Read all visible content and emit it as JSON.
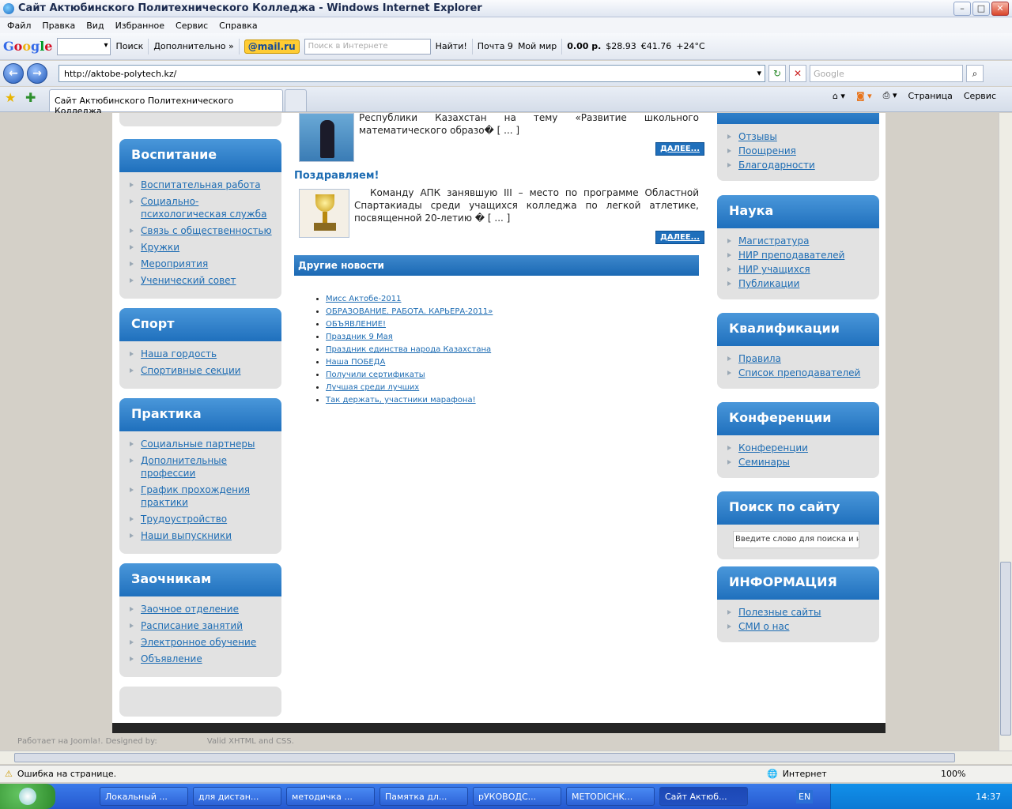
{
  "window": {
    "title": "Сайт Актюбинского Политехнического Колледжа - Windows Internet Explorer",
    "controls": {
      "min": "–",
      "max": "□",
      "close": "✕"
    }
  },
  "menu": [
    "Файл",
    "Правка",
    "Вид",
    "Избранное",
    "Сервис",
    "Справка"
  ],
  "toolbar": {
    "google_logo": [
      "G",
      "o",
      "o",
      "g",
      "l",
      "e"
    ],
    "search_label": "Поиск",
    "more_label": "Дополнительно »",
    "mailru": "@mail.ru",
    "internet_search_placeholder": "Поиск в Интернете",
    "find_label": "Найти!",
    "mail_label": "Почта 9",
    "myworld_label": "Мой мир",
    "balance": "0.00 р.",
    "usd": "$28.93",
    "eur": "€41.76",
    "weather": "+24°C"
  },
  "address": {
    "url": "http://aktobe-polytech.kz/",
    "back_icon": "←",
    "forward_icon": "→",
    "refresh_icon": "↻",
    "stop_icon": "✕",
    "search_placeholder": "Google",
    "search_icon": "⌕"
  },
  "tabs": {
    "active": "Сайт Актюбинского Политехнического Колледжа",
    "page_label": "Страница",
    "service_label": "Сервис"
  },
  "left_sidebar": [
    {
      "title": "Воспитание",
      "items": [
        "Воспитательная работа",
        "Социально-психологическая служба",
        "Связь с общественностью",
        "Кружки",
        "Мероприятия",
        "Ученический совет"
      ]
    },
    {
      "title": "Спорт",
      "items": [
        "Наша гордость",
        "Спортивные секции"
      ]
    },
    {
      "title": "Практика",
      "items": [
        "Социальные партнеры",
        "Дополнительные профессии",
        "График прохождения практики",
        "Трудоустройство",
        "Наши выпускники"
      ]
    },
    {
      "title": "Заочникам",
      "items": [
        "Заочное отделение",
        "Расписание занятий",
        "Электронное обучение",
        "Объявление"
      ]
    }
  ],
  "news": [
    {
      "title": "",
      "text": "Республики Казахстан на тему «Развитие школьного математического образо� [ ... ]",
      "more": "ДАЛЕЕ..."
    },
    {
      "title": "Поздравляем!",
      "text": "Команду АПК занявшую III – место по программе Областной Спартакиады среди учащихся колледжа по легкой атлетике, посвященной 20-летию � [ ... ]",
      "more": "ДАЛЕЕ..."
    }
  ],
  "other_news": {
    "title": "Другие новости",
    "items": [
      "Мисс Актобе-2011",
      "ОБРАЗОВАНИЕ. РАБОТА. КАРЬЕРА-2011»",
      "ОБЪЯВЛЕНИЕ!",
      "Праздник 9 Мая",
      "Праздник единства народа Казахстана",
      "Наша ПОБЕДА",
      "Получили сертификаты",
      "Лучшая среди лучших",
      "Так держать, участники марафона!"
    ]
  },
  "right_sidebar": [
    {
      "title": "",
      "items": [
        "Отзывы",
        "Поощрения",
        "Благодарности"
      ]
    },
    {
      "title": "Наука",
      "items": [
        "Магистратура",
        "НИР преподавателей",
        "НИР учащихся",
        "Публикации"
      ]
    },
    {
      "title": "Квалификации",
      "items": [
        "Правила",
        "Список преподавателей"
      ]
    },
    {
      "title": "Конференции",
      "items": [
        "Конференции",
        "Семинары"
      ]
    },
    {
      "title": "Поиск по сайту",
      "search_placeholder": "Введите слово для поиска и на"
    },
    {
      "title": "ИНФОРМАЦИЯ",
      "items": [
        "Полезные сайты",
        "СМИ о нас"
      ]
    }
  ],
  "footer": {
    "powered": "Работает на Joomla!. Designed by:",
    "valid": "Valid XHTML and CSS."
  },
  "status": {
    "error": "Ошибка на странице.",
    "zone": "Интернет",
    "zoom": "100%"
  },
  "taskbar": {
    "tasks": [
      "Локальный ...",
      "для дистан...",
      "методичка ...",
      "Памятка дл...",
      "рУКОВОДС...",
      "METODICHK...",
      "Сайт Актюб..."
    ],
    "lang": "EN",
    "time": "14:37"
  }
}
